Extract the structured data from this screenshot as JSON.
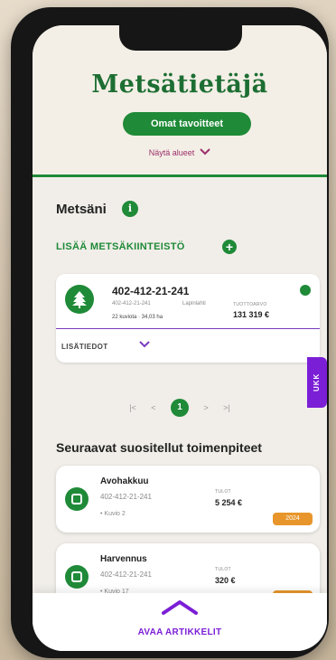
{
  "header": {
    "brand": "Metsätietäjä",
    "goals_button": "Omat tavoitteet",
    "show_areas": "Näytä alueet"
  },
  "forest": {
    "title": "Metsäni",
    "add_estate": "LISÄÄ METSÄKIINTEISTÖ",
    "estate": {
      "title": "402-412-21-241",
      "id": "402-412-21-241",
      "location": "Lapinlahti",
      "summary": "22 kuviota · 34,03 ha",
      "value_label": "TUOTTOARVO",
      "value": "131 319 €",
      "more": "LISÄTIEDOT"
    }
  },
  "faq_tab": "UKK",
  "pager": {
    "first": "|<",
    "prev": "<",
    "current": "1",
    "next": ">",
    "last": ">|"
  },
  "recommendations": {
    "title": "Seuraavat suositellut toimenpiteet",
    "items": [
      {
        "name": "Avohakkuu",
        "id": "402-412-21-241",
        "kuvio": "• Kuvio 2",
        "income_label": "TULOT",
        "income": "5 254 €",
        "year": "2024"
      },
      {
        "name": "Harvennus",
        "id": "402-412-21-241",
        "kuvio": "• Kuvio 17",
        "income_label": "TULOT",
        "income": "320 €",
        "year": "2024"
      }
    ]
  },
  "footer": {
    "open_articles": "AVAA ARTIKKELIT"
  },
  "colors": {
    "brand_green": "#1f8a38",
    "accent_purple": "#7b1fd6",
    "year_orange": "#e8962b",
    "link_magenta": "#9c2f6b"
  }
}
